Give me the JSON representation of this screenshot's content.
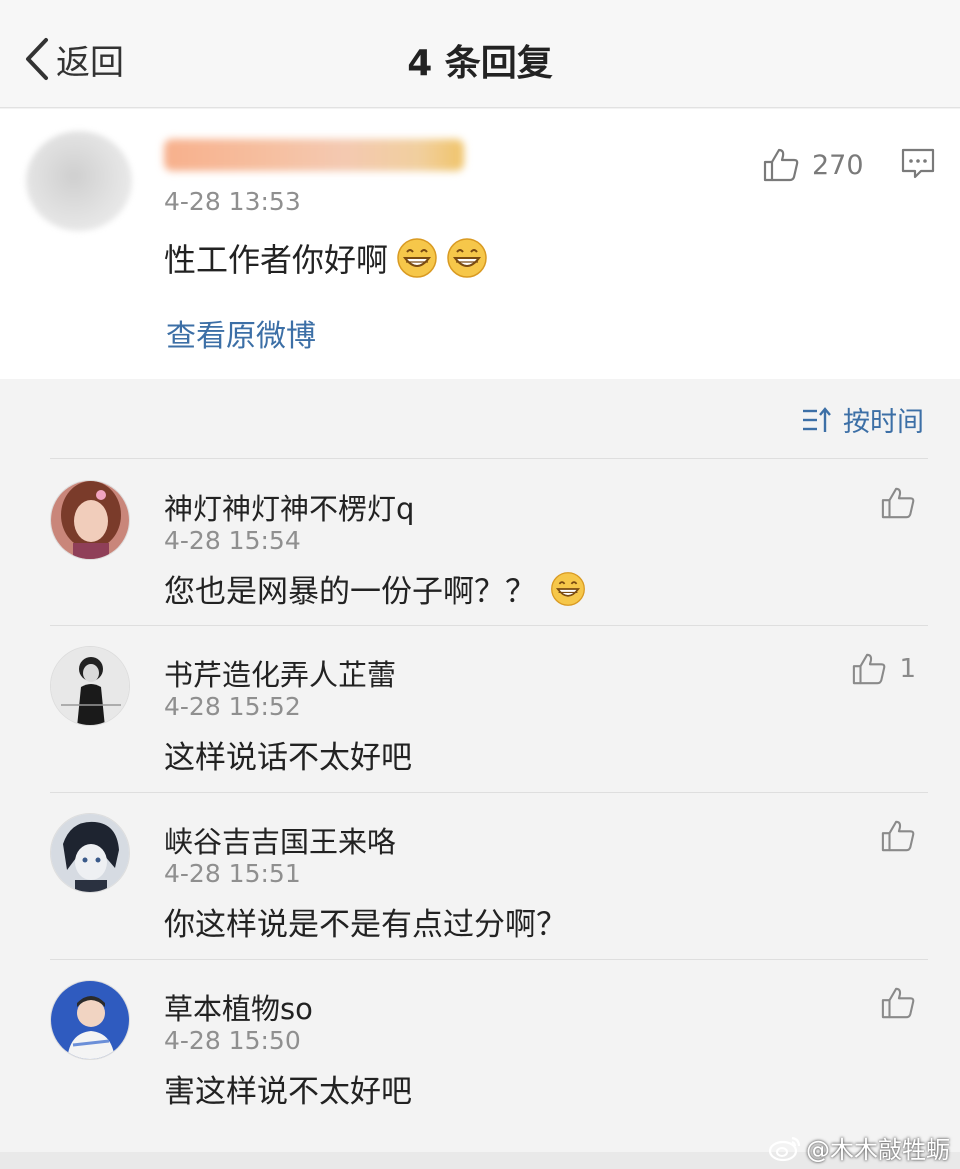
{
  "nav": {
    "back_label": "返回",
    "title": "4 条回复"
  },
  "original": {
    "time": "4-28 13:53",
    "text": "性工作者你好啊",
    "emojis": [
      "grin-emoji",
      "grin-emoji"
    ],
    "like_count": "270",
    "view_original_label": "查看原微博"
  },
  "sort": {
    "label": "按时间"
  },
  "replies": [
    {
      "name": "神灯神灯神不楞灯q",
      "time": "4-28 15:54",
      "text": "您也是网暴的一份子啊？？",
      "like_count": "",
      "emoji": "grin-emoji"
    },
    {
      "name": "书芹造化弄人芷蕾",
      "time": "4-28 15:52",
      "text": "这样说话不太好吧",
      "like_count": "1"
    },
    {
      "name": "峡谷吉吉国王来咯",
      "time": "4-28 15:51",
      "text": "你这样说是不是有点过分啊？",
      "like_count": ""
    },
    {
      "name": "草本植物so",
      "time": "4-28 15:50",
      "text": "害这样说不太好吧",
      "like_count": ""
    }
  ],
  "watermark": {
    "text": "@木木敲牲蛎"
  },
  "colors": {
    "link": "#3c6fa6",
    "meta": "#8f8f8f",
    "background": "#f3f3f3"
  }
}
